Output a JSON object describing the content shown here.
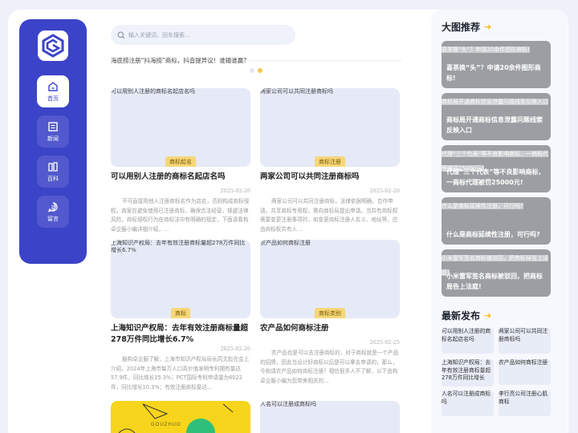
{
  "sidebar": {
    "items": [
      {
        "label": "首页",
        "icon": "home-icon"
      },
      {
        "label": "新闻",
        "icon": "news-icon"
      },
      {
        "label": "百科",
        "icon": "encyclopedia-icon"
      },
      {
        "label": "留言",
        "icon": "message-icon"
      }
    ]
  },
  "search": {
    "placeholder": "输入关键词，回车搜索..."
  },
  "banner": {
    "alt": "海底捞注册“抖海捞”商标，抖音提异议！谁输谁赢?"
  },
  "cards": [
    {
      "thumb_alt": "可以用别人注册的商标名起店名吗",
      "tag": "商标起名",
      "title": "可以用别人注册的商标名起店名吗",
      "date": "2025-02-26",
      "desc": "不可直接用他人注册商标名作为店名，否则构成商标侵权。商家应避免使用已注册商标，确保合法经营，规避法律风险。商标侵权行为在商标法中有明确的规定，下面请看构卓企服小编详细介绍，..."
    },
    {
      "thumb_alt": "两家公司可以共同注册商标吗",
      "tag": "商标注册",
      "title": "两家公司可以共同注册商标吗",
      "date": "2025-02-26",
      "desc": "两家公司可以共同注册商标，法律依据明确，合作申请，共享商标专用权，需向商标局提出申请。当共有商标权需要变更注册事项时，如变更商标注册人名义、地址等，应由商标权共有人..."
    },
    {
      "thumb_alt": "上海知识产权局：去年有效注册商标量超278万件同比增长6.7%",
      "tag": "商标",
      "title": "上海知识产权局：去年有效注册商标量超278万件同比增长6.7%",
      "date": "2025-02-26",
      "desc": "据构卓企服了解，上海市知识产权局局长芮文彪在会上介绍，2024年上海市每万人口高价值发明专利拥有量达57.9件，同比增长15.3%；PCT国际专利申请量为6022件，同比增长10.3%；有效注册商标量达..."
    },
    {
      "thumb_alt": "农产品如何商标注册",
      "tag": "商标类别",
      "title": "农产品如何商标注册",
      "date": "2025-02-25",
      "desc": "农产品也是可以去注册商标的，对于商标就是一个产品的招牌，因此当设计好商标以后是可以拿去申请的，那么，今和请农产品如何商标注册？相信很多人不了解，以下由构卓企服小编为您带来相关的..."
    }
  ],
  "bottom_cards": [
    {
      "thumb_text": "GOUZHUO"
    },
    {
      "thumb_alt": "人名可以注册成商标吗"
    }
  ],
  "right": {
    "big_title": "大图推荐",
    "big_items": [
      {
        "alt": "喜茶换“头”？申请20余件图形商标!",
        "caption": "喜茶换“头”？申请20余件图形商标!"
      },
      {
        "alt": "商标局开通商标信息泄露问题线索反映入口",
        "caption": "商标局开通商标信息泄露问题线索反映入口"
      },
      {
        "alt": "代理“三个代表”等不良影响商标，一商标代理被罚25000元!",
        "caption": "代理“三个代表”等不良影响商标，一商标代理被罚25000元!"
      },
      {
        "alt": "什么是商标延续性注册，可行吗?",
        "caption": "什么是商标延续性注册，可行吗?"
      },
      {
        "alt": "小米雷军签名商标被驳回，把商标局告上法庭!",
        "caption": "小米雷军签名商标被驳回，把商标局告上法庭!"
      }
    ],
    "new_title": "最新发布",
    "new_items": [
      "可以用别人注册的商标名起店名吗",
      "两家公司可以共同注册商标吗",
      "上海知识产权局：去年有效注册商标量超278万件同比增长",
      "农产品如何商标注册",
      "人名可以注册成商标吗",
      "李行亮公司注册心肌商标"
    ]
  },
  "colors": {
    "accent": "#3b43c8",
    "tag": "#f6d77a",
    "highlight": "#f4b91a"
  }
}
